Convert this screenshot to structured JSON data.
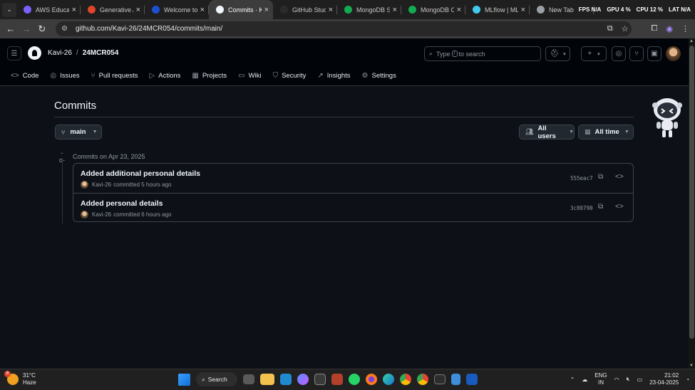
{
  "browser": {
    "tabs": [
      {
        "title": "AWS Educate",
        "color": "#7b61ff"
      },
      {
        "title": "Generative AI",
        "color": "#e0452b"
      },
      {
        "title": "Welcome to",
        "color": "#1f4fd1"
      },
      {
        "title": "Commits · Ka",
        "color": "#f0f6fc",
        "active": true
      },
      {
        "title": "GitHub Stude",
        "color": "#2b2b2b"
      },
      {
        "title": "MongoDB St",
        "color": "#13aa52"
      },
      {
        "title": "MongoDB Co",
        "color": "#13aa52"
      },
      {
        "title": "MLflow | MLf",
        "color": "#43c9ed"
      },
      {
        "title": "New Tab",
        "color": "#9aa0a6"
      }
    ],
    "stats": {
      "fps": "FPS N/A",
      "gpu": "GPU 4 %",
      "cpu": "CPU 12 %",
      "lat": "LAT N/A"
    },
    "url": "github.com/Kavi-26/24MCR054/commits/main/"
  },
  "header": {
    "owner": "Kavi-26",
    "separator": "/",
    "repo": "24MCR054",
    "search_placeholder_pre": "Type",
    "search_key": "/",
    "search_placeholder_post": "to search"
  },
  "repo_nav": [
    {
      "label": "Code",
      "icon": "<>"
    },
    {
      "label": "Issues",
      "icon": "◎"
    },
    {
      "label": "Pull requests",
      "icon": "⑂"
    },
    {
      "label": "Actions",
      "icon": "▷"
    },
    {
      "label": "Projects",
      "icon": "▦"
    },
    {
      "label": "Wiki",
      "icon": "▭"
    },
    {
      "label": "Security",
      "icon": "⛉"
    },
    {
      "label": "Insights",
      "icon": "↗"
    },
    {
      "label": "Settings",
      "icon": "⚙"
    }
  ],
  "page": {
    "title": "Commits",
    "branch": "main",
    "filter_users": "All users",
    "filter_time": "All time",
    "date_group": "Commits on Apr 23, 2025"
  },
  "commits": [
    {
      "message": "Added additional personal details",
      "author": "Kavi-26",
      "when": "committed 5 hours ago",
      "sha": "555eac7"
    },
    {
      "message": "Added personal details",
      "author": "Kavi-26",
      "when": "committed 6 hours ago",
      "sha": "3c80790"
    }
  ],
  "taskbar": {
    "weather_temp": "31°C",
    "weather_desc": "Haze",
    "weather_badge": "6",
    "search_label": "Search",
    "lang_1": "ENG",
    "lang_2": "IN",
    "time": "21:02",
    "date": "23-04-2025"
  }
}
